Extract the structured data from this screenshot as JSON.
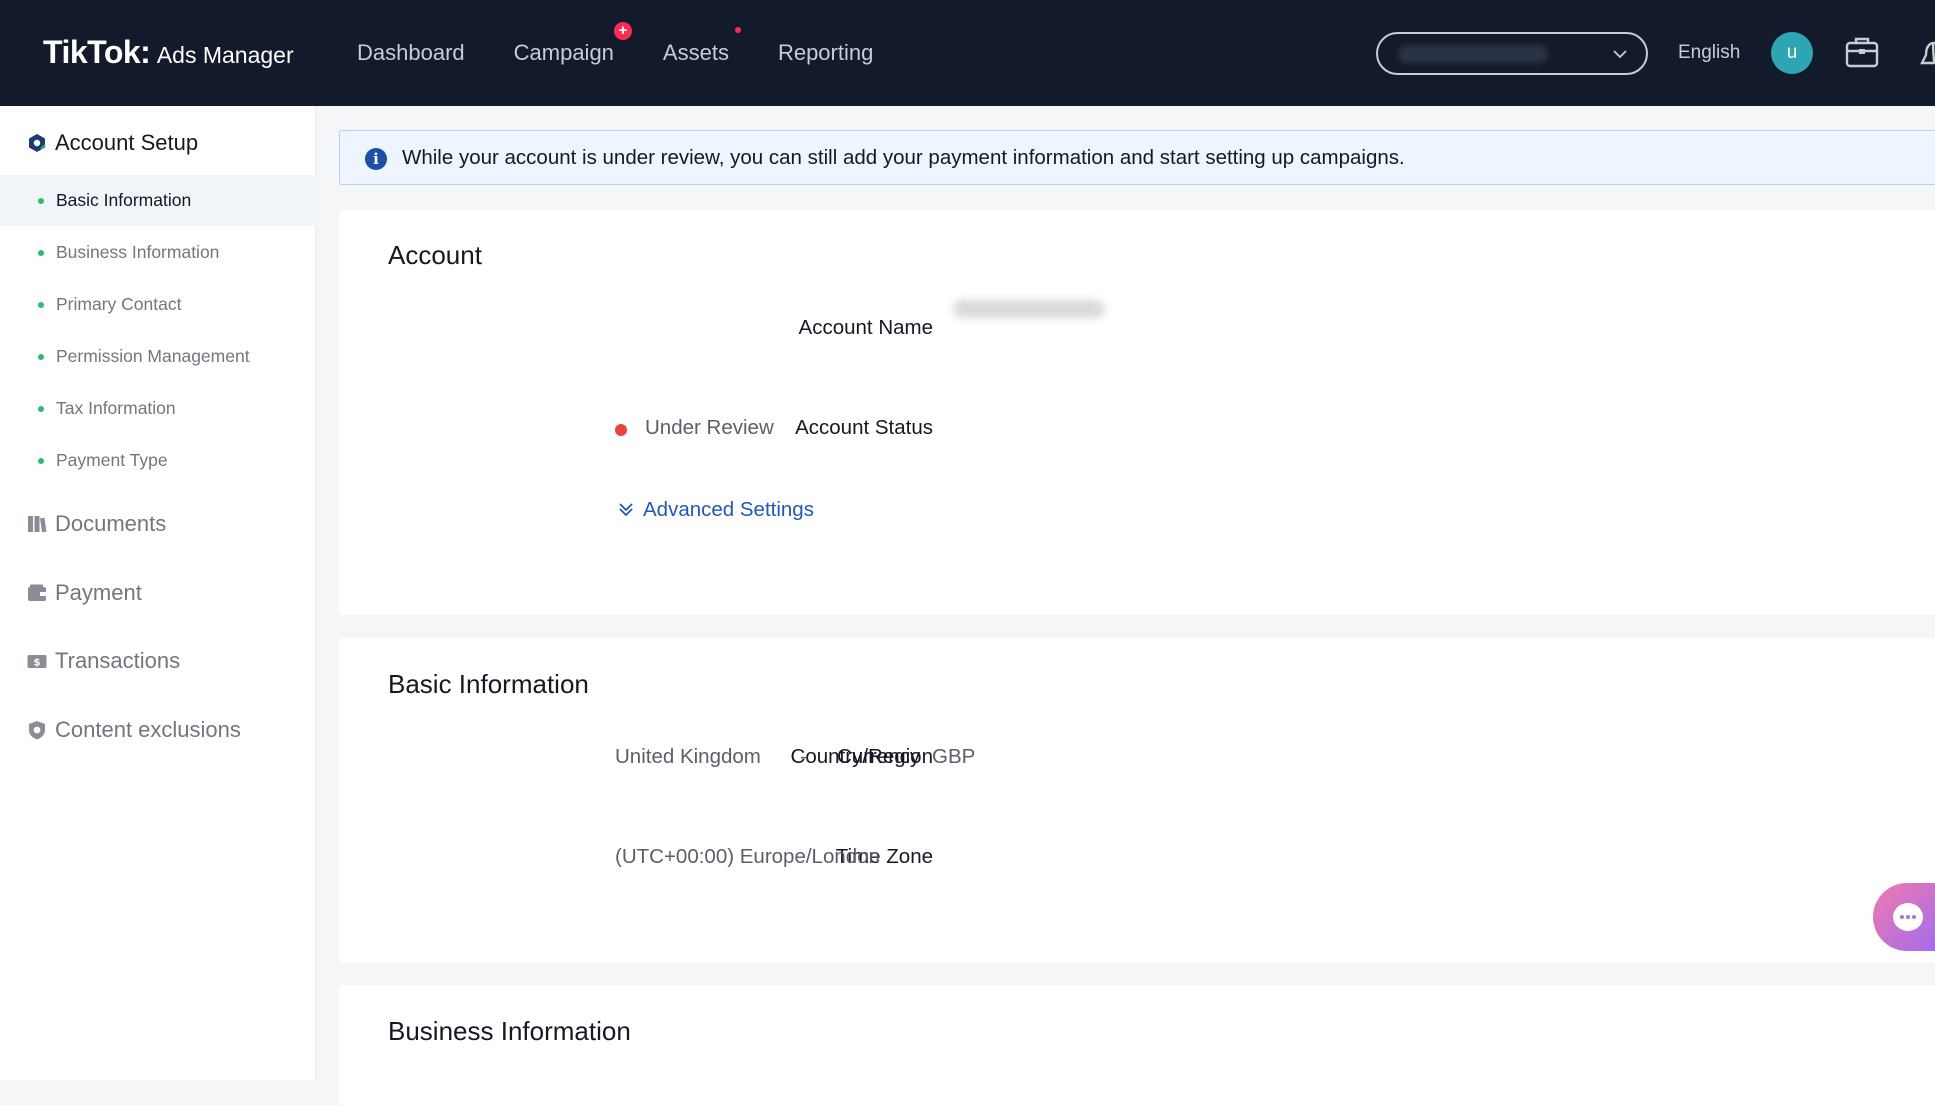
{
  "header": {
    "brand": "TikTok",
    "brand_colon": ":",
    "product": "Ads Manager",
    "nav": [
      {
        "label": "Dashboard"
      },
      {
        "label": "Campaign",
        "badge": "+"
      },
      {
        "label": "Assets"
      },
      {
        "label": "Reporting"
      }
    ],
    "language": "English",
    "avatar_initial": "u",
    "icons": [
      "chevron-down-icon",
      "toolbox-icon",
      "bell-icon"
    ]
  },
  "sidebar": {
    "account_setup": "Account Setup",
    "sub_items": [
      {
        "label": "Basic Information",
        "active": true
      },
      {
        "label": "Business Information"
      },
      {
        "label": "Primary Contact"
      },
      {
        "label": "Permission Management"
      },
      {
        "label": "Tax Information"
      },
      {
        "label": "Payment Type"
      }
    ],
    "sections": [
      {
        "label": "Documents",
        "icon": "documents-icon"
      },
      {
        "label": "Payment",
        "icon": "wallet-icon"
      },
      {
        "label": "Transactions",
        "icon": "transactions-icon"
      },
      {
        "label": "Content exclusions",
        "icon": "shield-icon"
      }
    ]
  },
  "notice": {
    "icon": "info-icon",
    "text": "While your account is under review, you can still add your payment information and start setting up campaigns."
  },
  "account_card": {
    "title": "Account",
    "account_name_label": "Account Name",
    "account_status_label": "Account Status",
    "account_status_value": "Under Review",
    "advanced_settings": "Advanced Settings"
  },
  "basic_info_card": {
    "title": "Basic Information",
    "country_label": "Country/Region",
    "country_value": "United Kingdom",
    "separator": "-",
    "currency_label": "Currency",
    "currency_value": "GBP",
    "timezone_label": "Time Zone",
    "timezone_value": "(UTC+00:00) Europe/London"
  },
  "business_info_card": {
    "title": "Business Information"
  },
  "colors": {
    "topbar": "#131a2b",
    "accent_link": "#2358b6",
    "status_red": "#e8433f",
    "bullet_green": "#25c16f",
    "badge_red": "#fe2c55"
  }
}
